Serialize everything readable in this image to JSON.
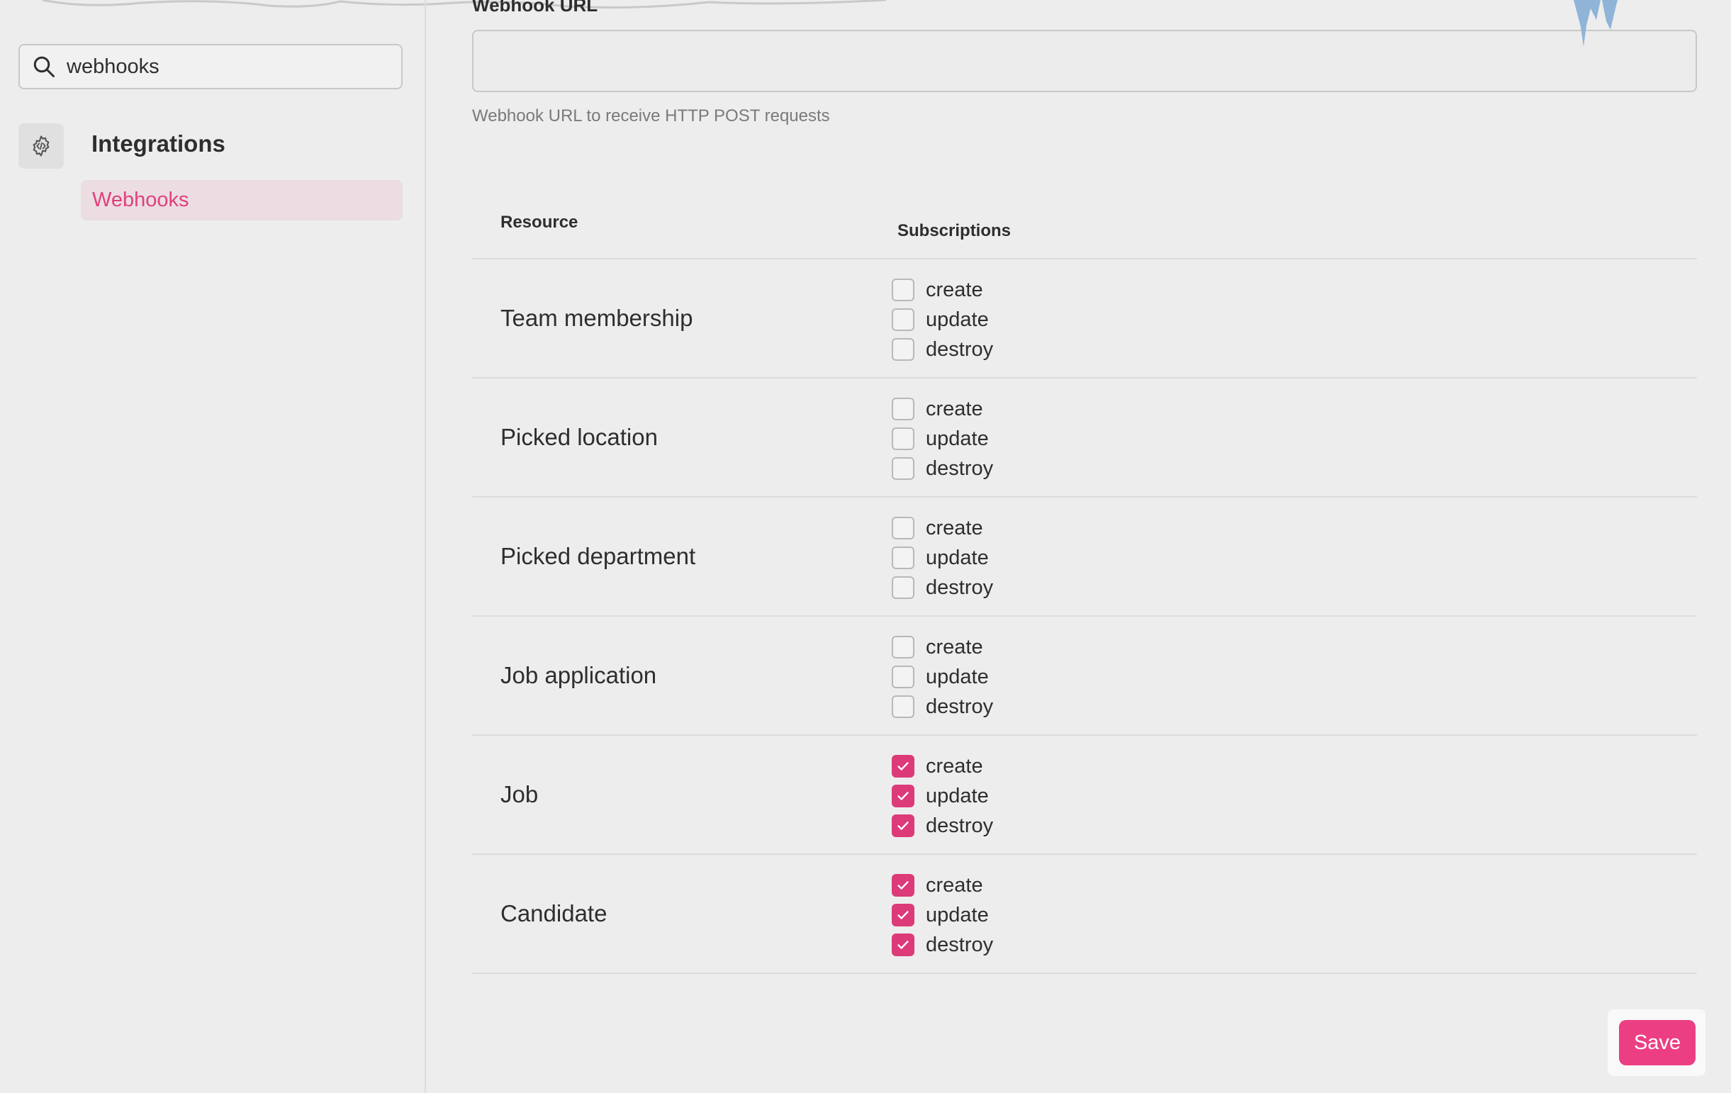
{
  "sidebar": {
    "search": {
      "value": "webhooks",
      "icon": "search-icon"
    },
    "section": {
      "title": "Integrations",
      "icon": "gear-code-icon"
    },
    "items": [
      {
        "label": "Webhooks",
        "active": true
      }
    ]
  },
  "form": {
    "url_label": "Webhook URL",
    "url_value": "",
    "url_help": "Webhook URL to receive HTTP POST requests"
  },
  "table": {
    "headers": {
      "resource": "Resource",
      "subscriptions": "Subscriptions"
    },
    "rows": [
      {
        "name": "Team membership",
        "subs": [
          {
            "label": "create",
            "checked": false
          },
          {
            "label": "update",
            "checked": false
          },
          {
            "label": "destroy",
            "checked": false
          }
        ]
      },
      {
        "name": "Picked location",
        "subs": [
          {
            "label": "create",
            "checked": false
          },
          {
            "label": "update",
            "checked": false
          },
          {
            "label": "destroy",
            "checked": false
          }
        ]
      },
      {
        "name": "Picked department",
        "subs": [
          {
            "label": "create",
            "checked": false
          },
          {
            "label": "update",
            "checked": false
          },
          {
            "label": "destroy",
            "checked": false
          }
        ]
      },
      {
        "name": "Job application",
        "subs": [
          {
            "label": "create",
            "checked": false
          },
          {
            "label": "update",
            "checked": false
          },
          {
            "label": "destroy",
            "checked": false
          }
        ]
      },
      {
        "name": "Job",
        "subs": [
          {
            "label": "create",
            "checked": true
          },
          {
            "label": "update",
            "checked": true
          },
          {
            "label": "destroy",
            "checked": true
          }
        ]
      },
      {
        "name": "Candidate",
        "subs": [
          {
            "label": "create",
            "checked": true
          },
          {
            "label": "update",
            "checked": true
          },
          {
            "label": "destroy",
            "checked": true
          }
        ]
      }
    ]
  },
  "actions": {
    "save_label": "Save"
  },
  "colors": {
    "accent": "#ec3f83",
    "checkbox_checked": "#dc3a78",
    "nav_active_bg": "#ebdde2",
    "nav_active_text": "#e0407f",
    "background": "#ededed"
  }
}
